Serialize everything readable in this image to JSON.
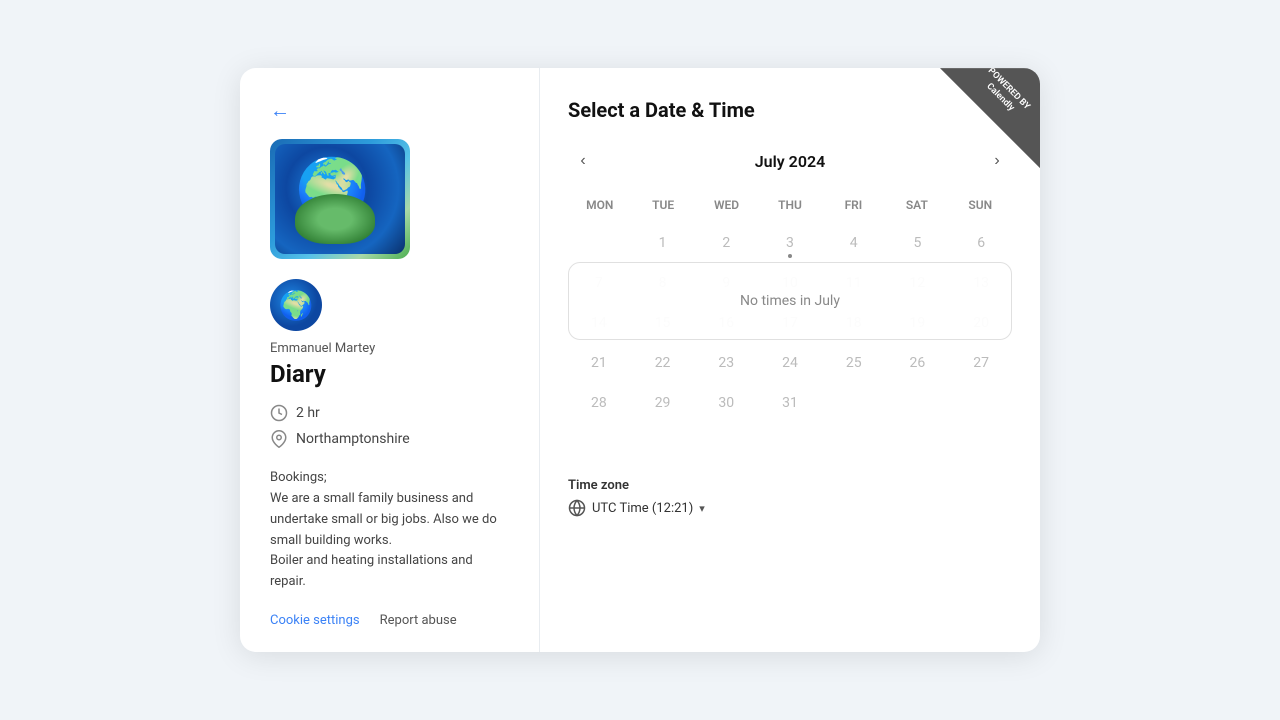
{
  "page": {
    "background": "#f0f4f8"
  },
  "left": {
    "back_label": "←",
    "host_name": "Emmanuel Martey",
    "event_title": "Diary",
    "duration": "2 hr",
    "location": "Northamptonshire",
    "description": "Bookings;\nWe are a small family business and undertake small or big jobs. Also we do small building works.\nBoiler and heating installations and repair.",
    "cookie_label": "Cookie settings",
    "report_label": "Report abuse"
  },
  "right": {
    "section_title": "Select a Date & Time",
    "month_label": "July 2024",
    "day_headers": [
      "MON",
      "TUE",
      "WED",
      "THU",
      "FRI",
      "SAT",
      "SUN"
    ],
    "no_times_message": "No times in July",
    "timezone_label": "Time zone",
    "timezone_value": "UTC Time (12:21)",
    "nav_prev": "‹",
    "nav_next": "›"
  },
  "calendly_badge": {
    "line1": "POWERED BY",
    "line2": "Calendly"
  },
  "calendar": {
    "weeks": [
      [
        {
          "day": "",
          "empty": true
        },
        {
          "day": "1"
        },
        {
          "day": "2"
        },
        {
          "day": "3",
          "dot": true
        },
        {
          "day": "4"
        },
        {
          "day": "5"
        },
        {
          "day": "6"
        },
        {
          "day": "7"
        }
      ],
      [
        {
          "day": "8"
        },
        {
          "day": "9"
        },
        {
          "day": "10"
        },
        {
          "day": "11"
        },
        {
          "day": "12"
        },
        {
          "day": "13"
        },
        {
          "day": "14"
        }
      ],
      [
        {
          "day": "15"
        },
        {
          "day": "16"
        },
        {
          "day": "17"
        },
        {
          "day": "18"
        },
        {
          "day": "19"
        },
        {
          "day": "20"
        },
        {
          "day": "21"
        }
      ],
      [
        {
          "day": "22"
        },
        {
          "day": "23"
        },
        {
          "day": "24"
        },
        {
          "day": "25"
        },
        {
          "day": "26"
        },
        {
          "day": "27"
        },
        {
          "day": "28"
        }
      ],
      [
        {
          "day": "29"
        },
        {
          "day": "30"
        },
        {
          "day": "31"
        },
        {
          "day": ""
        },
        {
          "day": ""
        },
        {
          "day": ""
        },
        {
          "day": ""
        }
      ]
    ]
  }
}
